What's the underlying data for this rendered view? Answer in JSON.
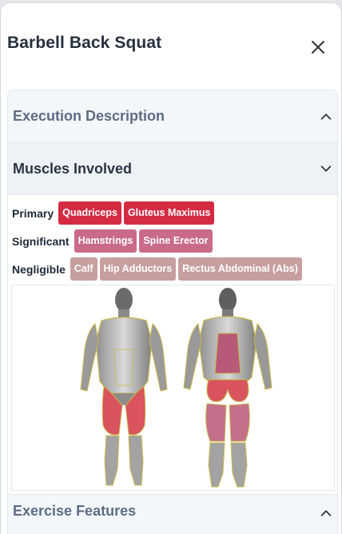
{
  "header": {
    "title": "Barbell Back Squat",
    "close_icon": "close-icon"
  },
  "sections": {
    "execution": {
      "label": "Execution Description",
      "state": "collapsed"
    },
    "muscles": {
      "label": "Muscles Involved",
      "state": "expanded"
    },
    "features": {
      "label": "Exercise Features",
      "state": "collapsed"
    }
  },
  "muscle_groups": {
    "primary": {
      "label": "Primary",
      "tags": [
        "Quadriceps",
        "Gluteus Maximus"
      ]
    },
    "significant": {
      "label": "Significant",
      "tags": [
        "Hamstrings",
        "Spine Erector"
      ]
    },
    "negligible": {
      "label": "Negligible",
      "tags": [
        "Calf",
        "Hip Adductors",
        "Rectus Abdominal (Abs)"
      ]
    }
  },
  "colors": {
    "primary": "#d42b43",
    "significant": "#c96b88",
    "negligible": "#c79f9f"
  }
}
